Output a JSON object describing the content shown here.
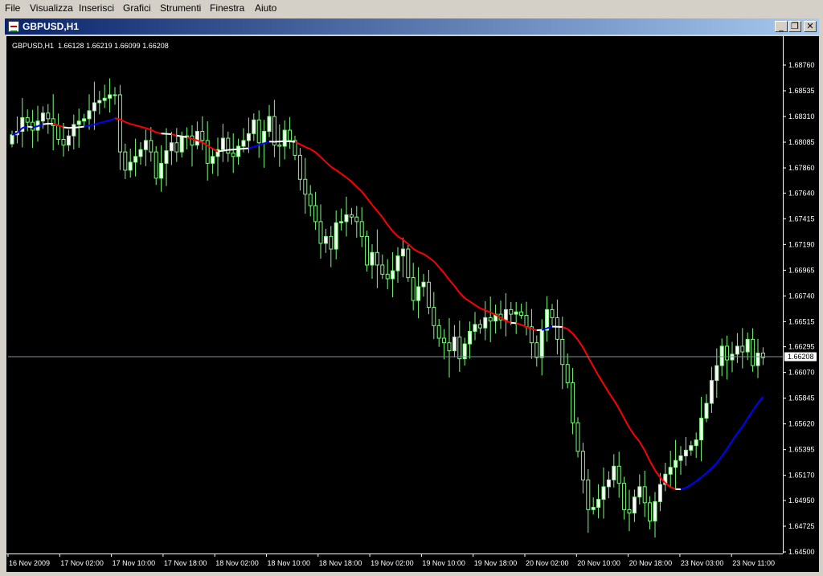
{
  "menu": [
    "File",
    "Visualizza",
    "Inserisci",
    "Grafici",
    "Strumenti",
    "Finestra",
    "Aiuto"
  ],
  "window": {
    "title": "GBPUSD,H1",
    "buttons": {
      "minimize": "_",
      "restore": "❐",
      "close": "✕"
    }
  },
  "chart_header": {
    "symbol": "GBPUSD,H1",
    "open": "1.66128",
    "high": "1.66219",
    "low": "1.66099",
    "close": "1.66208"
  },
  "colors": {
    "background": "#000000",
    "candle": "#7cfc7c",
    "candle_body_up": "#ffffff",
    "candle_body_down": "#000000",
    "ma_up": "#0000ff",
    "ma_down": "#ff0000",
    "ma_flat": "#ffffff",
    "axis": "#ffffff",
    "price_line": "#8090a0"
  },
  "chart_data": {
    "type": "candlestick",
    "instrument": "GBPUSD",
    "timeframe": "H1",
    "price_axis": {
      "min": 1.645,
      "max": 1.6876,
      "ticks": [
        "1.68760",
        "1.68535",
        "1.68310",
        "1.68085",
        "1.67860",
        "1.67640",
        "1.67415",
        "1.67190",
        "1.66965",
        "1.66740",
        "1.66515",
        "1.66295",
        "1.66070",
        "1.65845",
        "1.65620",
        "1.65395",
        "1.65170",
        "1.64950",
        "1.64725",
        "1.64500"
      ]
    },
    "current_price": "1.66208",
    "time_axis": [
      "16 Nov 2009",
      "17 Nov 02:00",
      "17 Nov 10:00",
      "17 Nov 18:00",
      "18 Nov 02:00",
      "18 Nov 10:00",
      "18 Nov 18:00",
      "19 Nov 02:00",
      "19 Nov 10:00",
      "19 Nov 18:00",
      "20 Nov 02:00",
      "20 Nov 10:00",
      "20 Nov 18:00",
      "23 Nov 03:00",
      "23 Nov 11:00"
    ],
    "closes": [
      1.6815,
      1.6818,
      1.683,
      1.6826,
      1.6819,
      1.6827,
      1.6834,
      1.6829,
      1.6823,
      1.6811,
      1.6806,
      1.6814,
      1.6824,
      1.6827,
      1.6829,
      1.6836,
      1.6843,
      1.6845,
      1.6847,
      1.685,
      1.685,
      1.68,
      1.6784,
      1.6791,
      1.6796,
      1.6802,
      1.681,
      1.68,
      1.6777,
      1.679,
      1.6801,
      1.6808,
      1.68,
      1.6813,
      1.6814,
      1.6806,
      1.6818,
      1.681,
      1.679,
      1.6796,
      1.6802,
      1.6812,
      1.6799,
      1.6796,
      1.6805,
      1.681,
      1.6816,
      1.6828,
      1.6808,
      1.6818,
      1.6831,
      1.6806,
      1.6805,
      1.6819,
      1.681,
      1.6797,
      1.6776,
      1.6763,
      1.6753,
      1.6739,
      1.672,
      1.6726,
      1.6715,
      1.6738,
      1.6739,
      1.6745,
      1.6743,
      1.6739,
      1.6726,
      1.6701,
      1.6712,
      1.6701,
      1.6693,
      1.6689,
      1.6696,
      1.6709,
      1.6715,
      1.669,
      1.667,
      1.6682,
      1.6686,
      1.6664,
      1.6648,
      1.6637,
      1.6633,
      1.6626,
      1.6638,
      1.6619,
      1.6632,
      1.6643,
      1.6649,
      1.6646,
      1.6655,
      1.6652,
      1.6658,
      1.6653,
      1.6662,
      1.6658,
      1.666,
      1.6657,
      1.6647,
      1.6633,
      1.662,
      1.6644,
      1.6662,
      1.6655,
      1.6636,
      1.6614,
      1.6598,
      1.6563,
      1.6538,
      1.6513,
      1.6487,
      1.6489,
      1.6496,
      1.6507,
      1.6513,
      1.6525,
      1.651,
      1.6487,
      1.6484,
      1.6498,
      1.6507,
      1.6493,
      1.6477,
      1.6494,
      1.6509,
      1.6518,
      1.6524,
      1.653,
      1.6534,
      1.6539,
      1.6543,
      1.6548,
      1.6567,
      1.658,
      1.66,
      1.6613,
      1.663,
      1.6618,
      1.6623,
      1.663,
      1.6625,
      1.6636,
      1.6613,
      1.6624,
      1.662
    ],
    "moving_average": {
      "type": "trend-colored MA",
      "colors": {
        "rising": "blue",
        "falling": "red",
        "neutral": "white"
      }
    }
  }
}
